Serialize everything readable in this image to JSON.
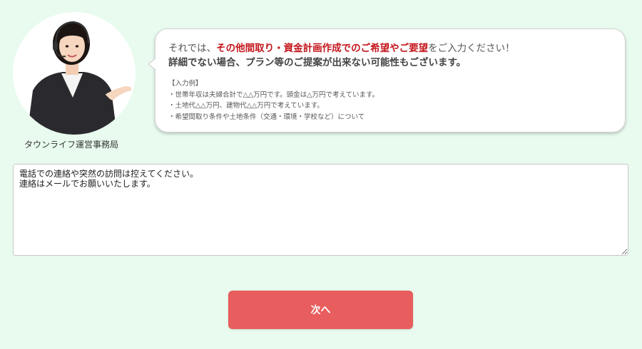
{
  "operator": {
    "label": "タウンライフ運営事務局",
    "avatar_icon": "operator-headset-avatar"
  },
  "bubble": {
    "prefix": "それでは、",
    "emphasis": "その他間取り・資金計画作成でのご希望やご要望",
    "suffix": "をご入力ください！",
    "notice": "詳細でない場合、プラン等のご提案が出来ない可能性もございます。",
    "example_title": "【入力例】",
    "examples": [
      "・世帯年収は夫婦合計で△△万円です。頭金は△万円で考えています。",
      "・土地代△△万円、建物代△△万円で考えています。",
      "・希望間取り条件や土地条件（交通・環境・学校など）について"
    ]
  },
  "form": {
    "message_value": "電話での連絡や突然の訪問は控えてください。\n連絡はメールでお願いいたします。"
  },
  "buttons": {
    "next_label": "次へ"
  },
  "colors": {
    "background": "#e8fbee",
    "emphasis": "#c4161c",
    "button": "#e85d5d"
  }
}
